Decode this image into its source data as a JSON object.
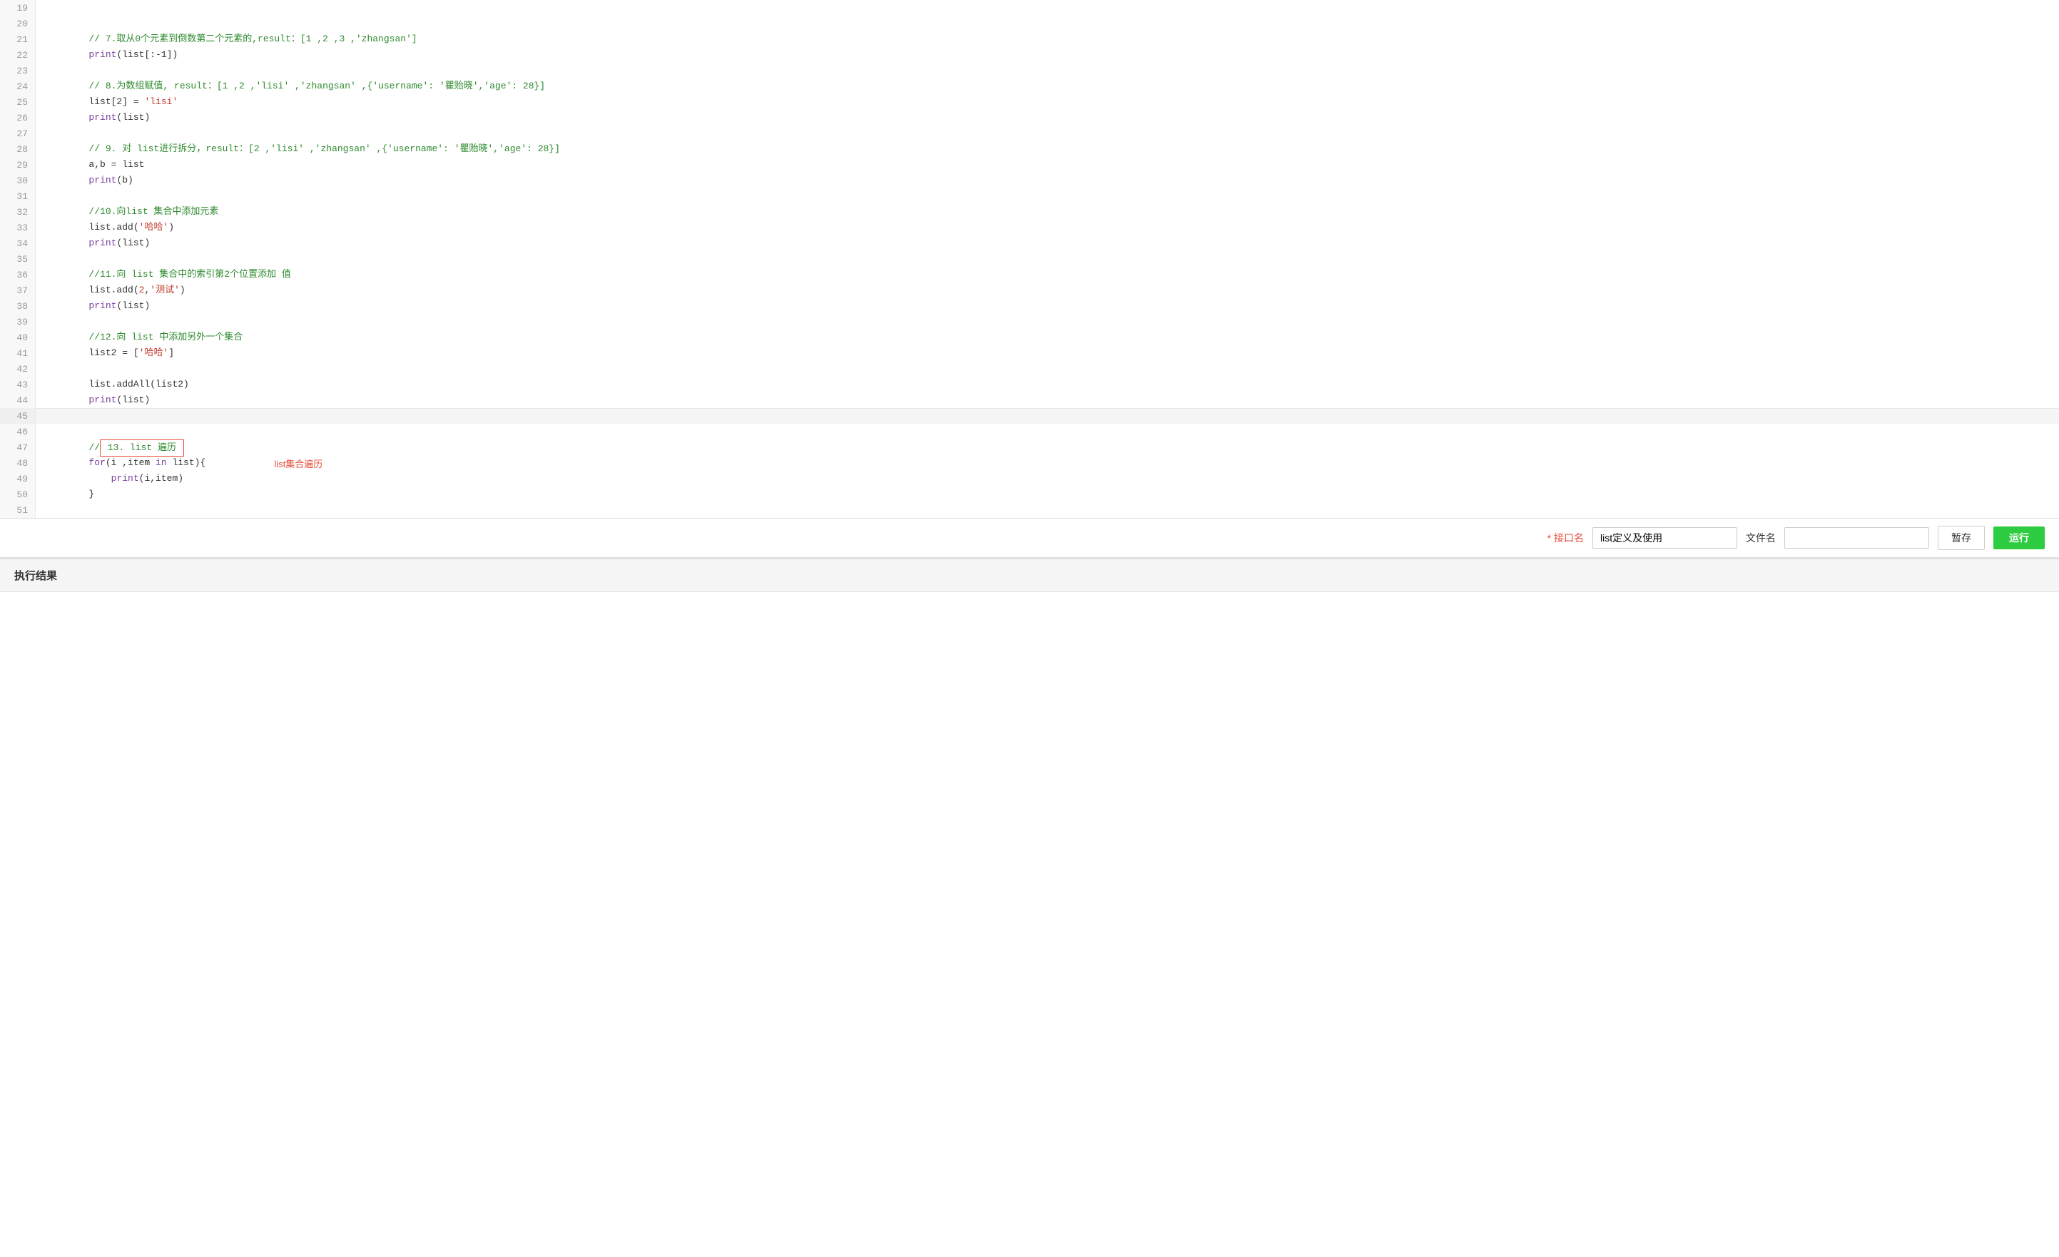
{
  "editor": {
    "lines": [
      {
        "num": 19,
        "content": "",
        "type": "empty"
      },
      {
        "num": 20,
        "content": "// 7.取从0个元素到倒数第二个元素的,result：[1 ,2 ,3 ,'zhangsan']",
        "type": "comment"
      },
      {
        "num": 21,
        "content": "print(list[:-1])",
        "type": "code"
      },
      {
        "num": 22,
        "content": "",
        "type": "empty"
      },
      {
        "num": 23,
        "content": "// 8.为数组赋值, result：[1 ,2 ,'lisi' ,'zhangsan' ,{'username': '瞿贻晓','age': 28}]",
        "type": "comment"
      },
      {
        "num": 24,
        "content": "list[2] = 'lisi'",
        "type": "code"
      },
      {
        "num": 25,
        "content": "print(list)",
        "type": "code"
      },
      {
        "num": 26,
        "content": "",
        "type": "empty"
      },
      {
        "num": 27,
        "content": "// 9. 对 list进行拆分，result：[2 ,'lisi' ,'zhangsan' ,{'username': '瞿贻晓','age': 28}]",
        "type": "comment"
      },
      {
        "num": 28,
        "content": "a,b = list",
        "type": "code"
      },
      {
        "num": 29,
        "content": "print(b)",
        "type": "code"
      },
      {
        "num": 30,
        "content": "",
        "type": "empty"
      },
      {
        "num": 31,
        "content": "//10.向list 集合中添加元素",
        "type": "comment"
      },
      {
        "num": 32,
        "content": "list.add('哈哈')",
        "type": "code"
      },
      {
        "num": 33,
        "content": "print(list)",
        "type": "code"
      },
      {
        "num": 34,
        "content": "",
        "type": "empty"
      },
      {
        "num": 35,
        "content": "//11.向 list 集合中的索引第2个位置添加 值",
        "type": "comment"
      },
      {
        "num": 36,
        "content": "list.add(2,'测试')",
        "type": "code"
      },
      {
        "num": 37,
        "content": "print(list)",
        "type": "code"
      },
      {
        "num": 38,
        "content": "",
        "type": "empty"
      },
      {
        "num": 39,
        "content": "//12.向 list 中添加另外一个集合",
        "type": "comment"
      },
      {
        "num": 40,
        "content": "list2 = ['哈哈']",
        "type": "code"
      },
      {
        "num": 41,
        "content": "",
        "type": "empty"
      },
      {
        "num": 42,
        "content": "list.addAll(list2)",
        "type": "code"
      },
      {
        "num": 43,
        "content": "print(list)",
        "type": "code"
      },
      {
        "num": 44,
        "content": "",
        "type": "empty"
      },
      {
        "num": 45,
        "content": "",
        "type": "separator"
      },
      {
        "num": 46,
        "content": "//13. list 遍历",
        "type": "comment_boxed",
        "annotation": "list集合遍历"
      },
      {
        "num": 47,
        "content": "for(i ,item in list){",
        "type": "code",
        "indent": 0
      },
      {
        "num": 48,
        "content": "    print(i,item)",
        "type": "code",
        "indent": 1
      },
      {
        "num": 49,
        "content": "}",
        "type": "code"
      },
      {
        "num": 50,
        "content": "",
        "type": "empty"
      },
      {
        "num": 51,
        "content": "",
        "type": "empty"
      }
    ]
  },
  "toolbar": {
    "interface_label": "接口名",
    "interface_value": "list定义及使用",
    "file_label": "文件名",
    "file_value": "",
    "file_placeholder": "",
    "save_label": "暂存",
    "run_label": "运行"
  },
  "result": {
    "section_title": "执行结果"
  }
}
